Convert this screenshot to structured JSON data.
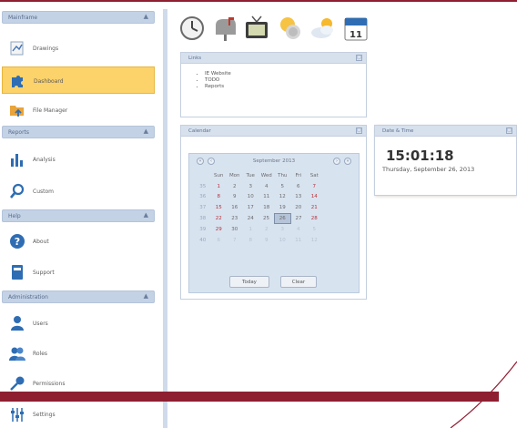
{
  "colors": {
    "accent": "#8e1f31",
    "active_item": "#fcd26a",
    "section_header": "#c4d2e6"
  },
  "sidebar": {
    "sections": [
      {
        "title": "Mainframe",
        "items": [
          {
            "label": "Drawings",
            "icon": "drawings-icon"
          },
          {
            "label": "Dashboard",
            "icon": "puzzle-icon",
            "active": true
          },
          {
            "label": "File Manager",
            "icon": "folder-upload-icon"
          }
        ]
      },
      {
        "title": "Reports",
        "items": [
          {
            "label": "Analysis",
            "icon": "bar-chart-icon"
          },
          {
            "label": "Custom",
            "icon": "search-icon"
          }
        ]
      },
      {
        "title": "Help",
        "items": [
          {
            "label": "About",
            "icon": "help-icon"
          },
          {
            "label": "Support",
            "icon": "support-book-icon"
          }
        ]
      },
      {
        "title": "Administration",
        "items": [
          {
            "label": "Users",
            "icon": "user-icon"
          },
          {
            "label": "Roles",
            "icon": "users-group-icon"
          },
          {
            "label": "Permissions",
            "icon": "key-icon"
          },
          {
            "label": "Settings",
            "icon": "sliders-icon"
          }
        ]
      }
    ]
  },
  "toolbar": {
    "icons": [
      "clock-icon",
      "mailbox-icon",
      "tv-icon",
      "notes-icon",
      "weather-icon",
      "calendar-icon"
    ],
    "calendar_day": "11"
  },
  "links_panel": {
    "title": "Links",
    "items": [
      "IE Website",
      "TODO",
      "Reports"
    ]
  },
  "calendar_panel": {
    "title": "Calendar",
    "month": "September 2013",
    "weekdays": [
      "Sun",
      "Mon",
      "Tue",
      "Wed",
      "Thu",
      "Fri",
      "Sat"
    ],
    "weeks": [
      [
        "35",
        "1",
        "2",
        "3",
        "4",
        "5",
        "6",
        "7"
      ],
      [
        "36",
        "8",
        "9",
        "10",
        "11",
        "12",
        "13",
        "14"
      ],
      [
        "37",
        "15",
        "16",
        "17",
        "18",
        "19",
        "20",
        "21"
      ],
      [
        "38",
        "22",
        "23",
        "24",
        "25",
        "26",
        "27",
        "28"
      ],
      [
        "39",
        "29",
        "30",
        "1",
        "2",
        "3",
        "4",
        "5"
      ],
      [
        "40",
        "6",
        "7",
        "8",
        "9",
        "10",
        "11",
        "12"
      ]
    ],
    "selected": "26",
    "today_label": "Today",
    "clear_label": "Clear"
  },
  "datetime_panel": {
    "title": "Date & Time",
    "time": "15:01:18",
    "date": "Thursday, September 26, 2013"
  }
}
